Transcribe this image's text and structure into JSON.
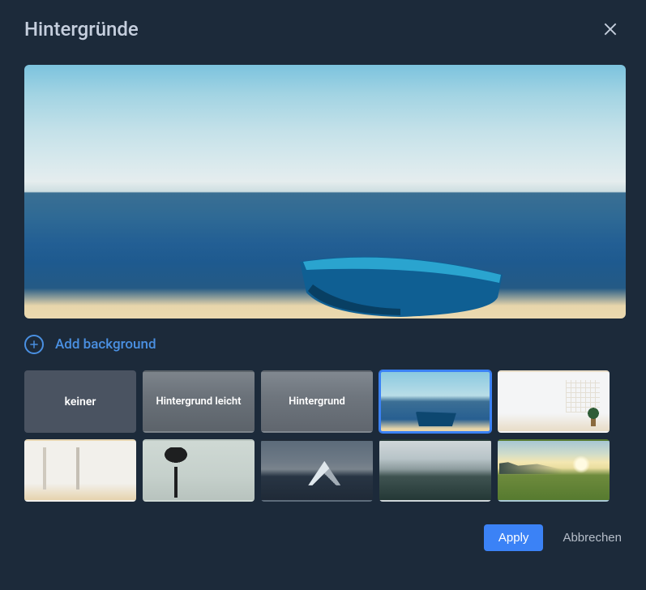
{
  "header": {
    "title": "Hintergründe"
  },
  "add_label": "Add background",
  "backgrounds": {
    "none_label": "keiner",
    "light_label": "Hintergrund leicht",
    "blur_label": "Hintergrund",
    "selected_index": 3
  },
  "footer": {
    "apply_label": "Apply",
    "cancel_label": "Abbrechen"
  },
  "colors": {
    "accent": "#3b82f6"
  }
}
